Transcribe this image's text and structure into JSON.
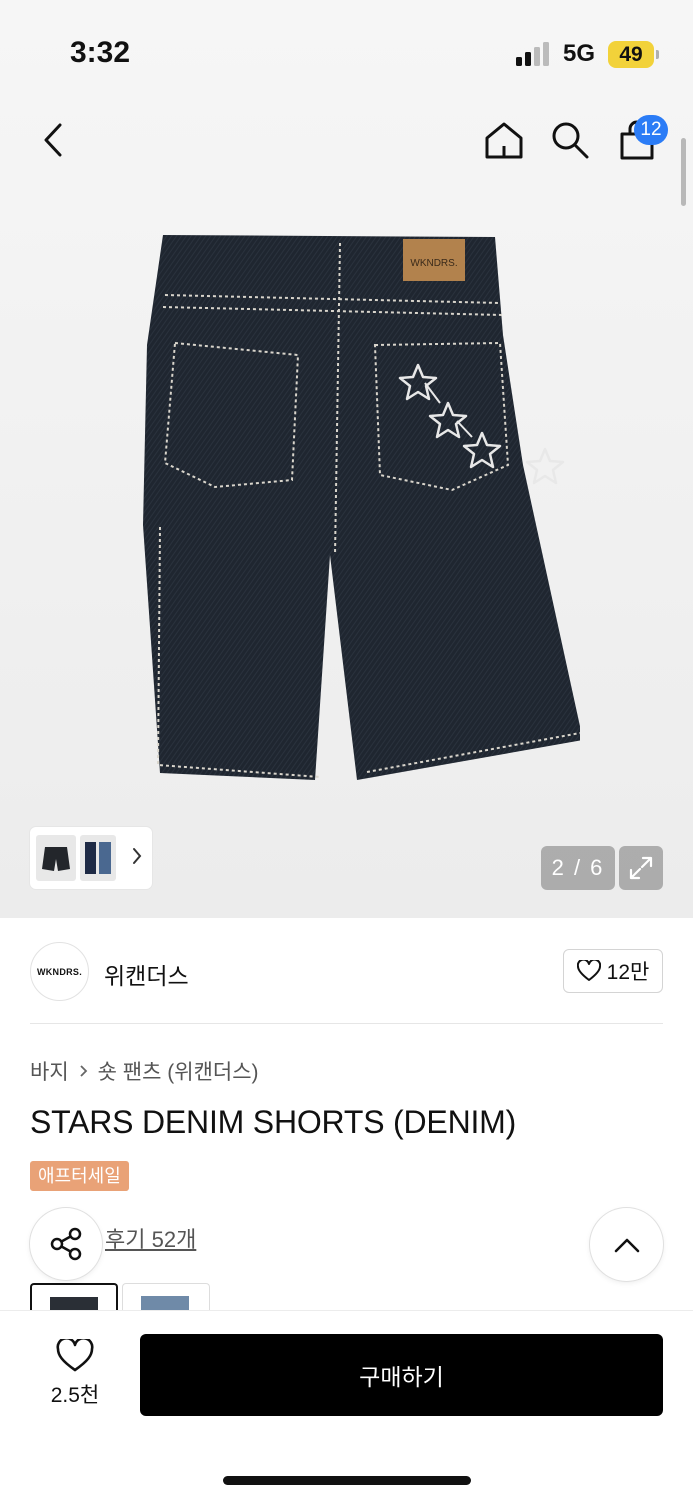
{
  "status_bar": {
    "time": "3:32",
    "network": "5G",
    "battery": "49"
  },
  "header": {
    "cart_count": "12"
  },
  "gallery": {
    "counter": "2 / 6"
  },
  "brand": {
    "logo_text": "WKNDRS.",
    "name": "위캔더스",
    "likes": "12만"
  },
  "breadcrumb": {
    "category": "바지",
    "subcategory": "숏 팬츠 (위캔더스)"
  },
  "product": {
    "title": "STARS DENIM SHORTS (DENIM)",
    "badge": "애프터세일",
    "reviews": "후기 52개",
    "label_text": "WKNDRS."
  },
  "bottom_bar": {
    "wish_count": "2.5천",
    "buy_label": "구매하기"
  },
  "colors": {
    "accent_blue": "#2b7cf6",
    "sale_badge": "#e9a277",
    "buy_button": "#000000",
    "battery": "#f2d23a",
    "denim": "#1f2630"
  }
}
